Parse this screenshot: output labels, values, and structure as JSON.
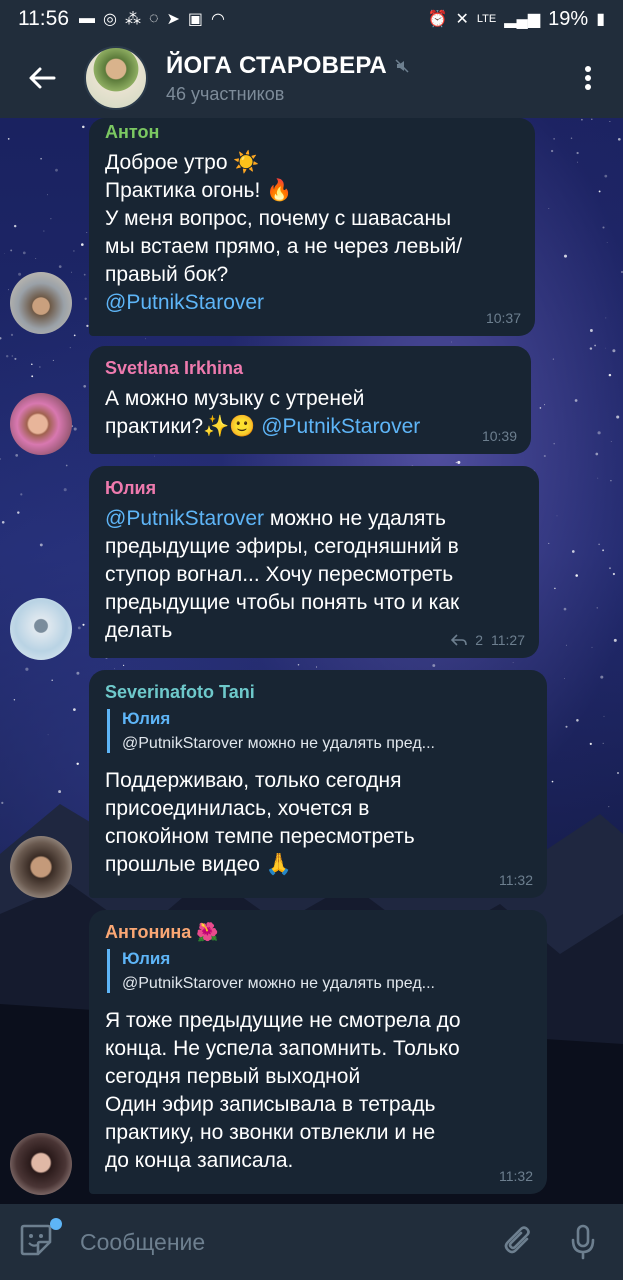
{
  "status_bar": {
    "time": "11:56",
    "battery": "19%",
    "network": "LTE"
  },
  "header": {
    "title": "ЙОГА СТАРОВЕРА",
    "subtitle": "46 участников",
    "icons": [
      "back-arrow-icon",
      "muted-icon",
      "more-vert-icon"
    ]
  },
  "messages": [
    {
      "sender": "Антон",
      "sender_color": "#7bc862",
      "lines": "Доброе утро ☀️\nПрактика огонь! 🔥\nУ меня вопрос, почему с шавасаны\nмы встаем прямо, а не через левый/\nправый бок?",
      "mention": "@PutnikStarover",
      "time": "10:37"
    },
    {
      "sender": "Svetlana Irkhina",
      "sender_color": "#ee7aae",
      "text": "А можно музыку с утреней\nпрактики?✨🙂 ",
      "mention": "@PutnikStarover",
      "time": "10:39"
    },
    {
      "sender": "Юлия",
      "sender_color": "#ee7aae",
      "mention": "@PutnikStarover",
      "text": " можно не удалять\nпредыдущие эфиры, сегодняшний в\nступор вогнал... Хочу пересмотреть\nпредыдущие чтобы понять что и как\nделать",
      "replies": "2",
      "time": "11:27"
    },
    {
      "sender": "Severinafoto Tani",
      "sender_color": "#6ec9cb",
      "reply_to": "Юлия",
      "reply_text": "@PutnikStarover можно не удалять пред...",
      "text": "Поддерживаю, только сегодня\nприсоединилась, хочется в\nспокойном темпе пересмотреть\nпрошлые видео 🙏",
      "time": "11:32"
    },
    {
      "sender": "Антонина 🌺",
      "sender_color": "#faa774",
      "reply_to": "Юлия",
      "reply_text": "@PutnikStarover можно не удалять пред...",
      "text": "Я тоже предыдущие не смотрела до\nконца. Не успела запомнить. Только\nсегодня первый выходной\nОдин эфир записывала в тетрадь\nпрактику, но звонки отвлекли и не\nдо конца записала.",
      "time": "11:32"
    }
  ],
  "input": {
    "placeholder": "Сообщение"
  }
}
